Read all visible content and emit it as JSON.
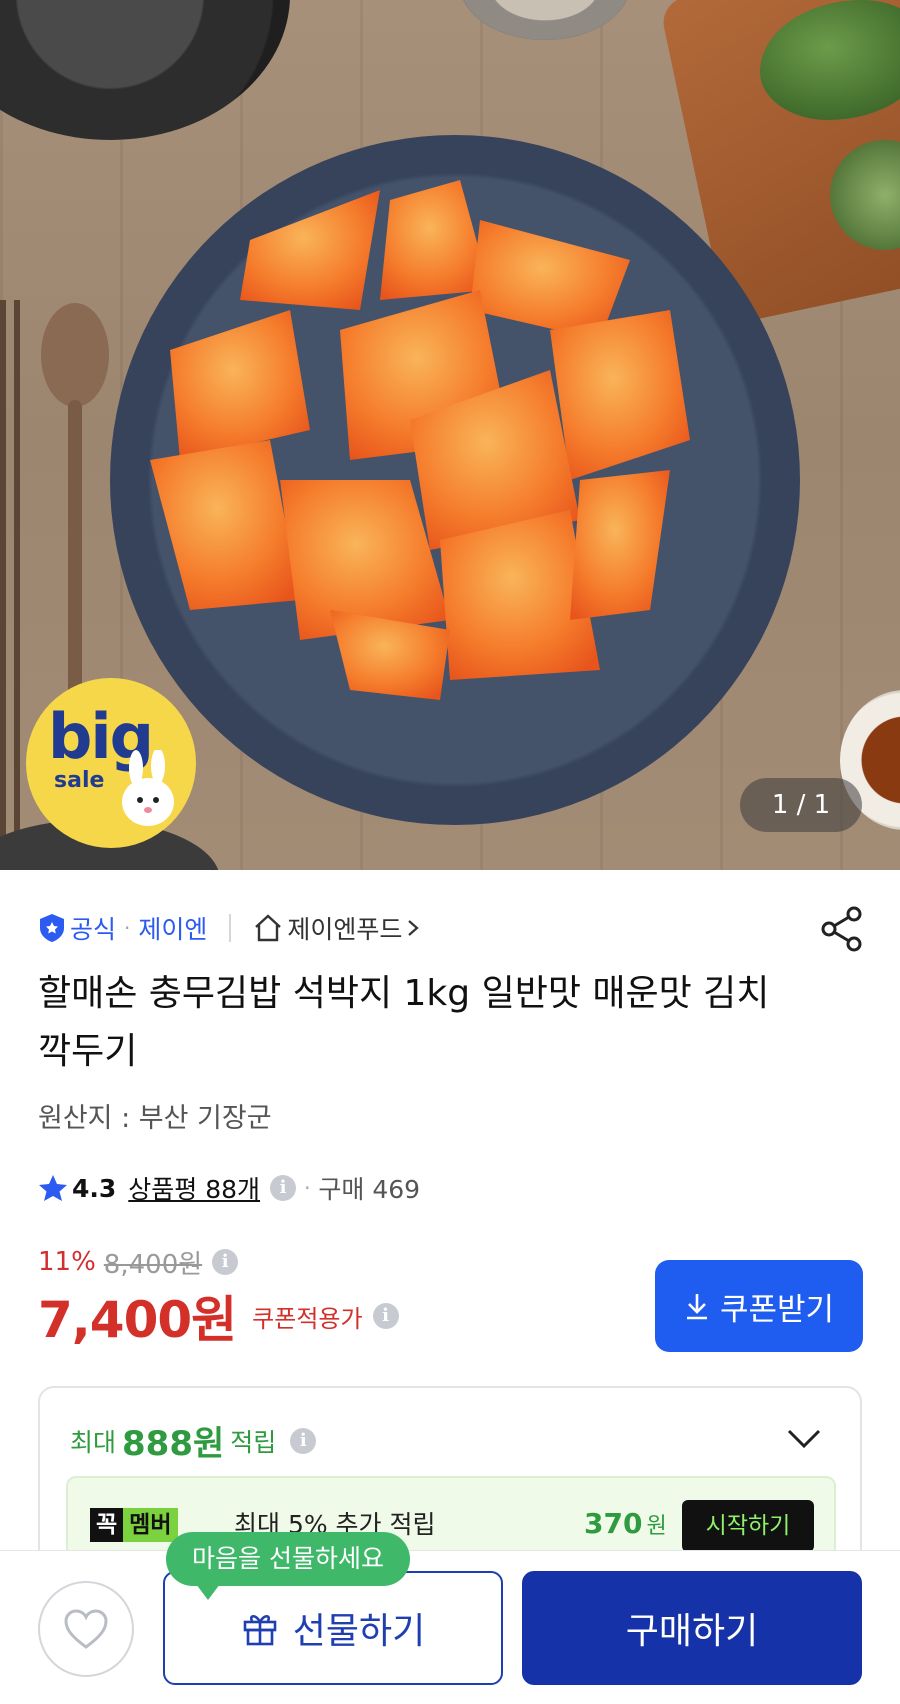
{
  "hero": {
    "image": "kimchi-radish-plate",
    "badge": {
      "big": "big",
      "sale": "sale"
    },
    "counter": "1 / 1"
  },
  "seller": {
    "official_label": "공식",
    "name": "제이엔",
    "store": "제이엔푸드"
  },
  "product": {
    "title": "할매손 충무김밥 석박지 1kg 일반맛 매운맛 김치 깍두기",
    "origin": "원산지 : 부산 기장군",
    "rating": "4.3",
    "reviews": "상품평 88개",
    "purchases": "구매 469"
  },
  "price": {
    "discount_pct": "11%",
    "original": "8,400원",
    "final": "7,400원",
    "final_note": "쿠폰적용가",
    "coupon_button": "쿠폰받기"
  },
  "reward": {
    "prefix": "최대",
    "amount": "888원",
    "suffix": "적립",
    "member_badge_a": "꼭",
    "member_badge_b": "멤버",
    "member_text": "최대 5% 추가 적립",
    "member_amount": "370",
    "member_unit": "원",
    "start_button": "시작하기"
  },
  "bottom": {
    "tooltip": "마음을 선물하세요",
    "gift_button": "선물하기",
    "buy_button": "구매하기"
  },
  "colors": {
    "accent_blue": "#1f5df1",
    "buy_navy": "#1532a8",
    "price_red": "#d3302a",
    "reward_green": "#2f9a3f"
  }
}
